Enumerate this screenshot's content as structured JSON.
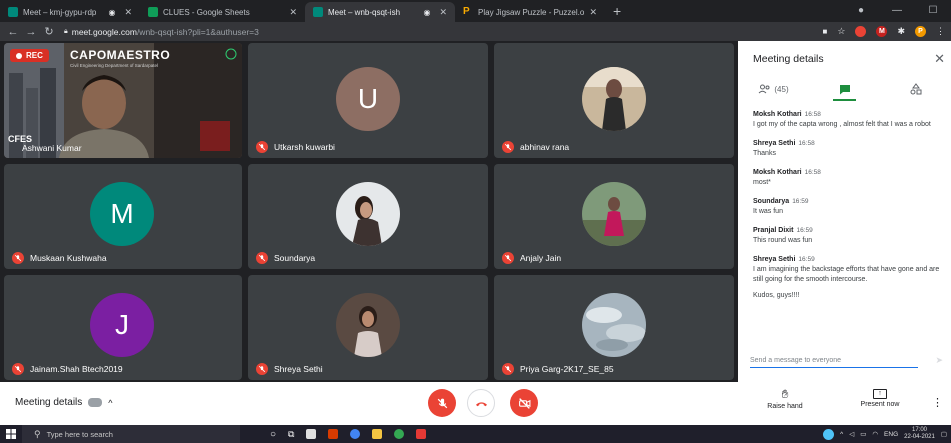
{
  "browser": {
    "tabs": [
      {
        "title": "Meet – kmj-gypu-rdp",
        "color": "#00897b",
        "active": false,
        "indicator": "◉"
      },
      {
        "title": "CLUES - Google Sheets",
        "color": "#0f9d58",
        "active": false,
        "indicator": ""
      },
      {
        "title": "Meet – wnb-qsqt-ish",
        "color": "#00897b",
        "active": true,
        "indicator": "◉"
      },
      {
        "title": "Play Jigsaw Puzzle - Puzzel.org",
        "color": "#f9ab00",
        "active": false,
        "indicator": ""
      }
    ],
    "new_tab": "+",
    "url_host": "meet.google.com",
    "url_path": "/wnb-qsqt-ish?pli=1&authuser=3"
  },
  "grid": {
    "rec_label": "REC",
    "brand": "CAPOMAESTRO",
    "brand_sub": "Civil Engineering Department of Sardarpatel",
    "cfes_label": "CFES",
    "participants": [
      {
        "name": "Ashwani Kumar",
        "kind": "video"
      },
      {
        "name": "Utkarsh kuwarbi",
        "kind": "letter",
        "letter": "U",
        "color": "#8d6e63"
      },
      {
        "name": "abhinav rana",
        "kind": "photo",
        "color": "#6d4c41"
      },
      {
        "name": "Muskaan Kushwaha",
        "kind": "letter",
        "letter": "M",
        "color": "#00897b"
      },
      {
        "name": "Soundarya",
        "kind": "photo",
        "color": "#b0bec5"
      },
      {
        "name": "Anjaly Jain",
        "kind": "photo",
        "color": "#8d6e63"
      },
      {
        "name": "Jainam.Shah Btech2019",
        "kind": "letter",
        "letter": "J",
        "color": "#7b1fa2"
      },
      {
        "name": "Shreya Sethi",
        "kind": "photo",
        "color": "#795548"
      },
      {
        "name": "Priya Garg-2K17_SE_85",
        "kind": "photo",
        "color": "#90a4ae"
      }
    ]
  },
  "panel": {
    "title": "Meeting details",
    "people_count": "(45)",
    "messages": [
      {
        "sender": "Moksh Kothari",
        "time": "16:58",
        "text": "I got my of the capta wrong , almost felt that I was a robot"
      },
      {
        "sender": "Shreya Sethi",
        "time": "16:58",
        "text": "Thanks"
      },
      {
        "sender": "Moksh Kothari",
        "time": "16:58",
        "text": "most*"
      },
      {
        "sender": "Soundarya",
        "time": "16:59",
        "text": "It was fun"
      },
      {
        "sender": "Pranjal Dixit",
        "time": "16:59",
        "text": "This round was fun"
      },
      {
        "sender": "Shreya Sethi",
        "time": "16:59",
        "text": "I am imagining the backstage efforts that have gone and are still going for the smooth intercourse."
      },
      {
        "sender": "",
        "time": "",
        "text": "Kudos, guys!!!!"
      }
    ],
    "send_placeholder": "Send a message to everyone"
  },
  "bottom": {
    "meeting_details": "Meeting details",
    "raise_hand": "Raise hand",
    "present_now": "Present now"
  },
  "taskbar": {
    "search_placeholder": "Type here to search",
    "lang": "ENG",
    "time": "17:00",
    "date": "22-04-2021"
  }
}
